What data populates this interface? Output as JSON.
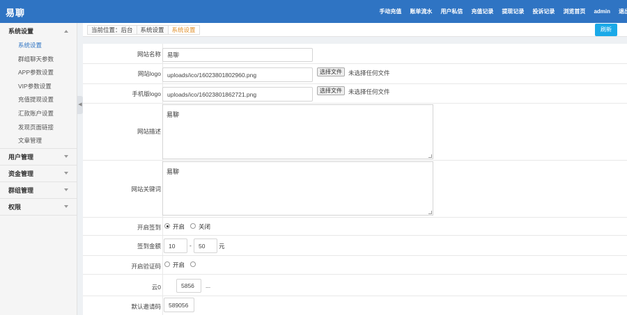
{
  "brand": "易聊",
  "topnav": [
    "手动充值",
    "账单流水",
    "用户私信",
    "充值记录",
    "提现记录",
    "投诉记录",
    "浏览首页",
    "admin",
    "退出"
  ],
  "sidebar": {
    "groups": [
      {
        "title": "系统设置",
        "expanded": true,
        "items": [
          "系统设置",
          "群组聊天参数",
          "APP参数设置",
          "VIP参数设置",
          "充值提现设置",
          "汇款账户设置",
          "发现页面链接",
          "文章管理"
        ],
        "active_index": 0
      },
      {
        "title": "用户管理",
        "expanded": false
      },
      {
        "title": "资金管理",
        "expanded": false
      },
      {
        "title": "群组管理",
        "expanded": false
      },
      {
        "title": "权限",
        "expanded": false
      }
    ]
  },
  "breadcrumb": [
    "当前位置：后台",
    "系统设置",
    "系统设置"
  ],
  "refresh_label": "刷新",
  "form": {
    "site_name": {
      "label": "网站名称",
      "value": "易聊"
    },
    "site_logo": {
      "label": "网站logo",
      "value": "uploads/ico/16023801802960.png",
      "button": "选择文件",
      "status": "未选择任何文件"
    },
    "mobile_logo": {
      "label": "手机版logo",
      "value": "uploads/ico/16023801862721.png",
      "button": "选择文件",
      "status": "未选择任何文件"
    },
    "site_desc": {
      "label": "网站描述",
      "value": "易聊"
    },
    "site_keywords": {
      "label": "网站关键词",
      "value": "易聊"
    },
    "signin": {
      "label": "开启签到",
      "options": [
        "开启",
        "关闭"
      ],
      "selected": 0
    },
    "signin_amount": {
      "label": "签到金额",
      "min": "10",
      "sep": "-",
      "max": "50",
      "unit": "元"
    },
    "captcha": {
      "label": "开启验证码",
      "option": "开启"
    },
    "row_b": {
      "label": "云0",
      "value": "5856",
      "suffix": "..."
    },
    "invite": {
      "label": "默认邀请码",
      "value": "589056"
    }
  },
  "colors": {
    "topbar": "#2f74c3",
    "active": "#2f74c3",
    "refresh": "#1aa9e8",
    "crumb_current": "#e0902c"
  }
}
